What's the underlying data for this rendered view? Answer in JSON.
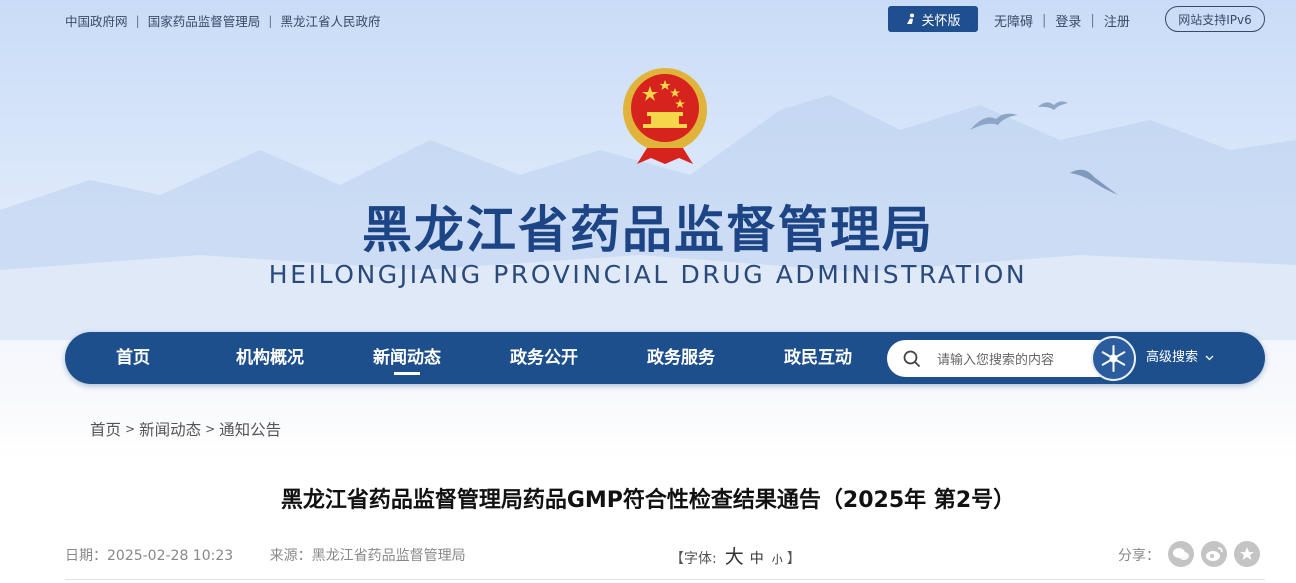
{
  "top_links": [
    "中国政府网",
    "国家药品监督管理局",
    "黑龙江省人民政府"
  ],
  "care_mode": "关怀版",
  "accessibility": "无障碍",
  "login": "登录",
  "register": "注册",
  "ipv6": "网站支持IPv6",
  "site_title_cn": "黑龙江省药品监督管理局",
  "site_title_en": "HEILONGJIANG PROVINCIAL DRUG ADMINISTRATION",
  "nav": {
    "items": [
      "首页",
      "机构概况",
      "新闻动态",
      "政务公开",
      "政务服务",
      "政民互动"
    ],
    "active": "新闻动态",
    "search_placeholder": "请输入您搜索的内容",
    "advanced_search": "高级搜索"
  },
  "breadcrumb": [
    "首页",
    "新闻动态",
    "通知公告"
  ],
  "breadcrumb_sep": ">",
  "article": {
    "title": "黑龙江省药品监督管理局药品GMP符合性检查结果通告（2025年 第2号）",
    "date_label": "日期：2025-02-28 10:23",
    "source_label": "来源：黑龙江省药品监督管理局",
    "font_label": "【字体:",
    "font_large": "大",
    "font_medium": "中",
    "font_small": "小",
    "font_close": "】",
    "share_label": "分享："
  },
  "colors": {
    "nav_bg": "#1e4f8d",
    "title_blue": "#1d4586",
    "care_btn": "#1f4f8f"
  }
}
